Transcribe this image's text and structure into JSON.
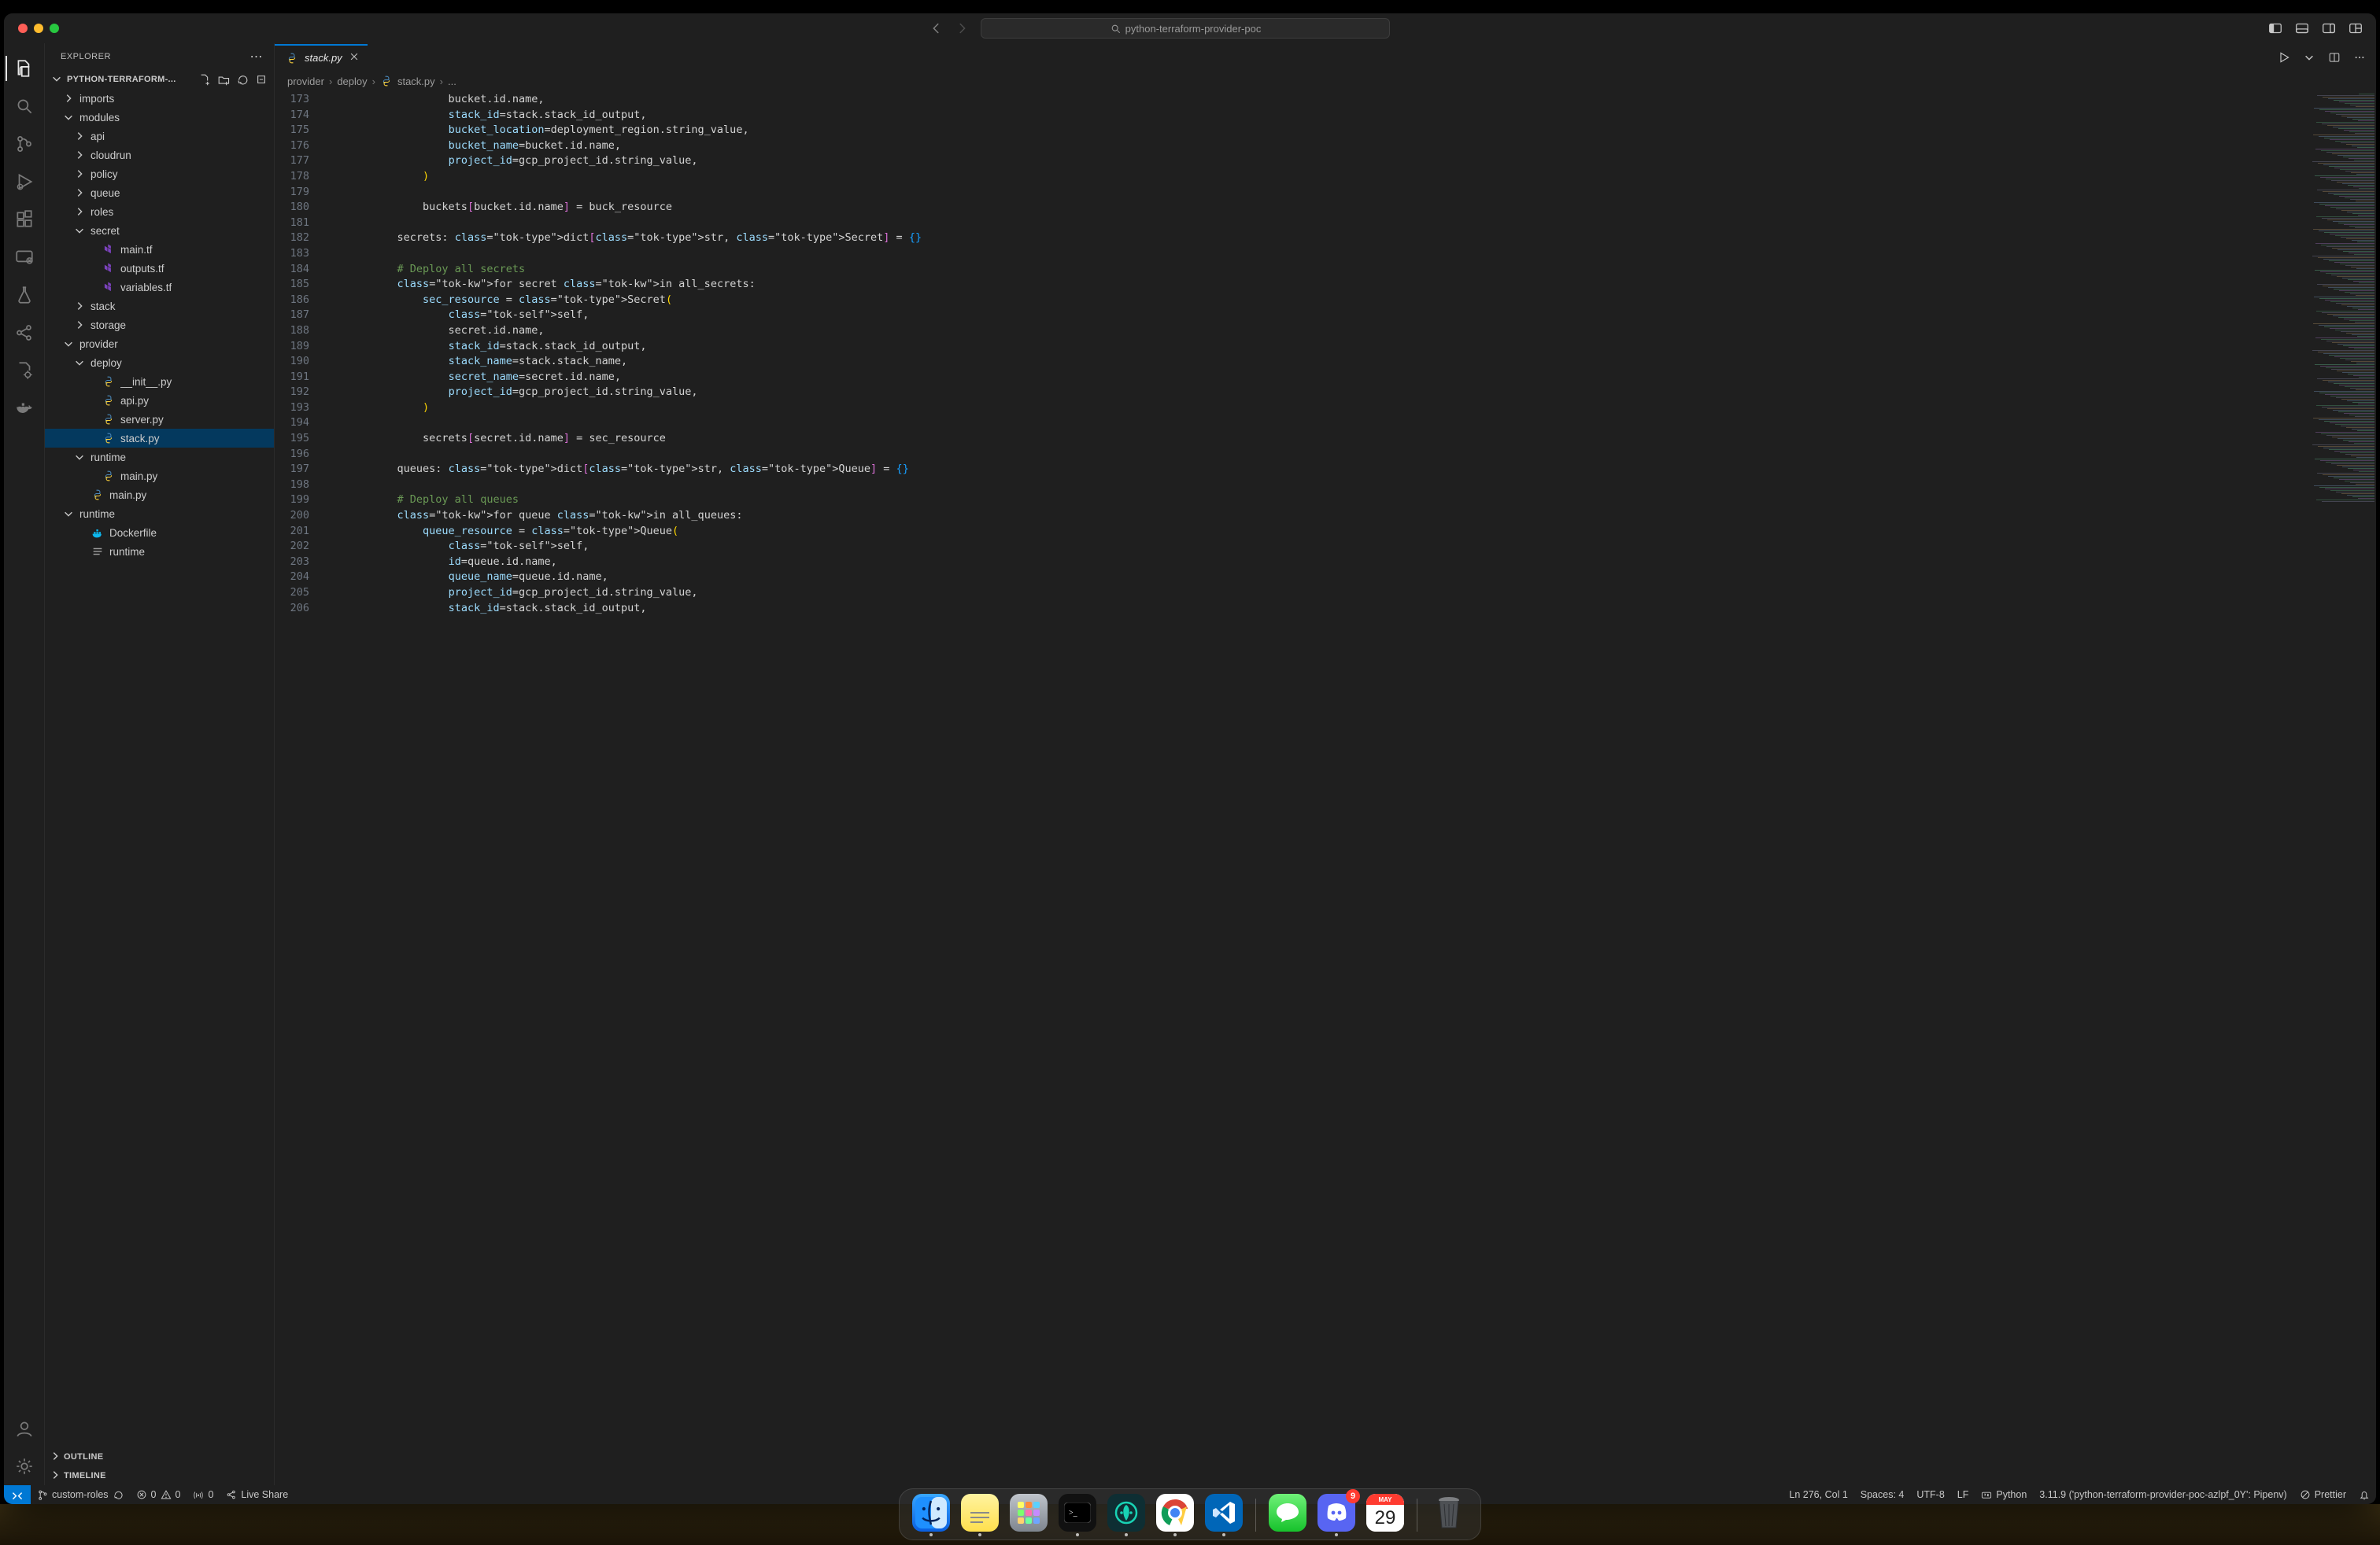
{
  "title_bar": {
    "search_icon": "search",
    "search_text": "python-terraform-provider-poc",
    "nav_back_enabled": true,
    "nav_fwd_enabled": false
  },
  "activity": {
    "items": [
      {
        "name": "explorer",
        "active": true
      },
      {
        "name": "search"
      },
      {
        "name": "scm"
      },
      {
        "name": "run-debug"
      },
      {
        "name": "extensions"
      },
      {
        "name": "remote-explorer"
      },
      {
        "name": "testing"
      },
      {
        "name": "ports"
      },
      {
        "name": "resources"
      },
      {
        "name": "docker"
      }
    ],
    "bottom": [
      {
        "name": "accounts"
      },
      {
        "name": "settings"
      }
    ]
  },
  "sidebar": {
    "title": "EXPLORER",
    "root_label": "PYTHON-TERRAFORM-...",
    "tree": [
      {
        "depth": 1,
        "kind": "folder",
        "open": false,
        "label": "imports"
      },
      {
        "depth": 1,
        "kind": "folder",
        "open": true,
        "label": "modules"
      },
      {
        "depth": 2,
        "kind": "folder",
        "open": false,
        "label": "api"
      },
      {
        "depth": 2,
        "kind": "folder",
        "open": false,
        "label": "cloudrun"
      },
      {
        "depth": 2,
        "kind": "folder",
        "open": false,
        "label": "policy"
      },
      {
        "depth": 2,
        "kind": "folder",
        "open": false,
        "label": "queue"
      },
      {
        "depth": 2,
        "kind": "folder",
        "open": false,
        "label": "roles"
      },
      {
        "depth": 2,
        "kind": "folder",
        "open": true,
        "label": "secret"
      },
      {
        "depth": 3,
        "kind": "file",
        "icon": "tf",
        "label": "main.tf"
      },
      {
        "depth": 3,
        "kind": "file",
        "icon": "tf",
        "label": "outputs.tf"
      },
      {
        "depth": 3,
        "kind": "file",
        "icon": "tf",
        "label": "variables.tf"
      },
      {
        "depth": 2,
        "kind": "folder",
        "open": false,
        "label": "stack"
      },
      {
        "depth": 2,
        "kind": "folder",
        "open": false,
        "label": "storage"
      },
      {
        "depth": 1,
        "kind": "folder",
        "open": true,
        "label": "provider"
      },
      {
        "depth": 2,
        "kind": "folder",
        "open": true,
        "label": "deploy"
      },
      {
        "depth": 3,
        "kind": "file",
        "icon": "py",
        "label": "__init__.py"
      },
      {
        "depth": 3,
        "kind": "file",
        "icon": "py",
        "label": "api.py"
      },
      {
        "depth": 3,
        "kind": "file",
        "icon": "py",
        "label": "server.py"
      },
      {
        "depth": 3,
        "kind": "file",
        "icon": "py",
        "label": "stack.py",
        "selected": true
      },
      {
        "depth": 2,
        "kind": "folder",
        "open": true,
        "label": "runtime"
      },
      {
        "depth": 3,
        "kind": "file",
        "icon": "py",
        "label": "main.py"
      },
      {
        "depth": 2,
        "kind": "file",
        "icon": "py",
        "label": "main.py"
      },
      {
        "depth": 1,
        "kind": "folder",
        "open": true,
        "label": "runtime"
      },
      {
        "depth": 2,
        "kind": "file",
        "icon": "docker",
        "label": "Dockerfile"
      },
      {
        "depth": 2,
        "kind": "file",
        "icon": "txt",
        "label": "runtime"
      }
    ],
    "sections": [
      {
        "label": "OUTLINE",
        "open": false
      },
      {
        "label": "TIMELINE",
        "open": false
      }
    ]
  },
  "editor": {
    "tab_label": "stack.py",
    "tab_icon": "py",
    "breadcrumbs": [
      {
        "label": "provider"
      },
      {
        "label": "deploy"
      },
      {
        "label": "stack.py",
        "icon": "py"
      },
      {
        "label": "..."
      }
    ],
    "first_line_no": 173,
    "last_line_no": 206,
    "lines": [
      "                    bucket.id.name,",
      "                    stack_id=stack.stack_id_output,",
      "                    bucket_location=deployment_region.string_value,",
      "                    bucket_name=bucket.id.name,",
      "                    project_id=gcp_project_id.string_value,",
      "                )",
      "",
      "                buckets[bucket.id.name] = buck_resource",
      "",
      "            secrets: dict[str, Secret] = {}",
      "",
      "            # Deploy all secrets",
      "            for secret in all_secrets:",
      "                sec_resource = Secret(",
      "                    self,",
      "                    secret.id.name,",
      "                    stack_id=stack.stack_id_output,",
      "                    stack_name=stack.stack_name,",
      "                    secret_name=secret.id.name,",
      "                    project_id=gcp_project_id.string_value,",
      "                )",
      "",
      "                secrets[secret.id.name] = sec_resource",
      "",
      "            queues: dict[str, Queue] = {}",
      "",
      "            # Deploy all queues",
      "            for queue in all_queues:",
      "                queue_resource = Queue(",
      "                    self,",
      "                    id=queue.id.name,",
      "                    queue_name=queue.id.name,",
      "                    project_id=gcp_project_id.string_value,",
      "                    stack_id=stack.stack_id_output,"
    ]
  },
  "status": {
    "remote": "remote",
    "branch_label": "custom-roles",
    "sync_icon": "sync",
    "errors": "0",
    "warnings": "0",
    "ports_icon": "antenna",
    "ports_count": "0",
    "live_share": "Live Share",
    "cursor": "Ln 276, Col 1",
    "spaces": "Spaces: 4",
    "encoding": "UTF-8",
    "eol": "LF",
    "language": "Python",
    "interpreter": "3.11.9 ('python-terraform-provider-poc-azlpf_0Y': Pipenv)",
    "prettier": "Prettier"
  },
  "dock": {
    "items": [
      {
        "name": "finder",
        "running": true,
        "bg": "linear-gradient(#39a7ff,#0a5fe0)"
      },
      {
        "name": "notes",
        "running": true,
        "bg": "linear-gradient(#fff3a0,#ffe04d)"
      },
      {
        "name": "launchpad",
        "running": false,
        "bg": "linear-gradient(#bfc4cb,#7e858e)"
      },
      {
        "name": "terminal",
        "running": true,
        "bg": "#111"
      },
      {
        "name": "gitkraken",
        "running": true,
        "bg": "#0e2e33"
      },
      {
        "name": "chrome",
        "running": true,
        "bg": "#fff"
      },
      {
        "name": "vscode",
        "running": true,
        "bg": "#0066b8"
      },
      {
        "sep": true
      },
      {
        "name": "messages",
        "running": false,
        "bg": "linear-gradient(#6ff178,#17c22c)"
      },
      {
        "name": "discord",
        "running": true,
        "bg": "#5865f2",
        "badge": "9"
      },
      {
        "name": "calendar",
        "running": false,
        "bg": "#fff",
        "cal_month": "MAY",
        "cal_day": "29"
      },
      {
        "sep": true
      },
      {
        "name": "trash",
        "running": false,
        "bg": "transparent"
      }
    ]
  }
}
